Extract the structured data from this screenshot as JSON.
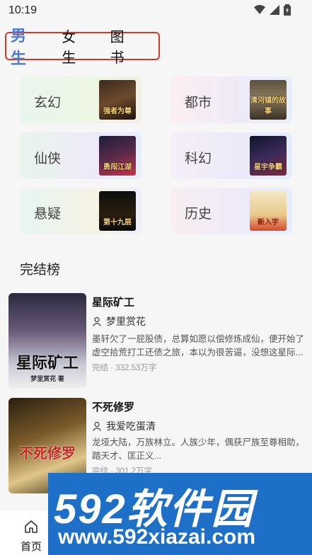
{
  "status_bar": {
    "time": "10:19"
  },
  "tabs": [
    {
      "label": "男生",
      "active": true
    },
    {
      "label": "女生",
      "active": false
    },
    {
      "label": "图书",
      "active": false
    }
  ],
  "genres": [
    {
      "label": "玄幻",
      "cover_text": "强者为尊"
    },
    {
      "label": "都市",
      "cover_text": "清河镇的故事"
    },
    {
      "label": "仙侠",
      "cover_text": "勇闯江湖"
    },
    {
      "label": "科幻",
      "cover_text": "星宇争霸"
    },
    {
      "label": "悬疑",
      "cover_text": "第十九层"
    },
    {
      "label": "历史",
      "cover_text": "新入字"
    }
  ],
  "section": {
    "title": "完结榜"
  },
  "books": [
    {
      "title": "星际矿工",
      "author": "梦里赏花",
      "description": "墨轩欠了一屁股债，总算如愿以偿修炼成仙，便开始了虚空拾荒打工还债之旅，本以为很苦逼，没想这星际...",
      "status": "完结",
      "word_count": "332.53万字",
      "cover_text": "星际矿工",
      "cover_author": "梦里赏花 著"
    },
    {
      "title": "不死修罗",
      "author": "我爱吃蛋清",
      "description": "龙垭大陆，万族林立。人族少年，偶获尸族至尊相助，踏天才、匡正义...",
      "status": "完结",
      "word_count": "301.2万字",
      "cover_text": "不死修罗",
      "cover_author": ""
    }
  ],
  "bottom_nav": {
    "home_label": "首页"
  },
  "watermark": {
    "brand": "592软件园",
    "url": "www.592xiazai.com"
  },
  "colors": {
    "accent": "#4a7bd0",
    "tab_border": "#d33a2c",
    "watermark_bg": "#1e6fc8"
  }
}
